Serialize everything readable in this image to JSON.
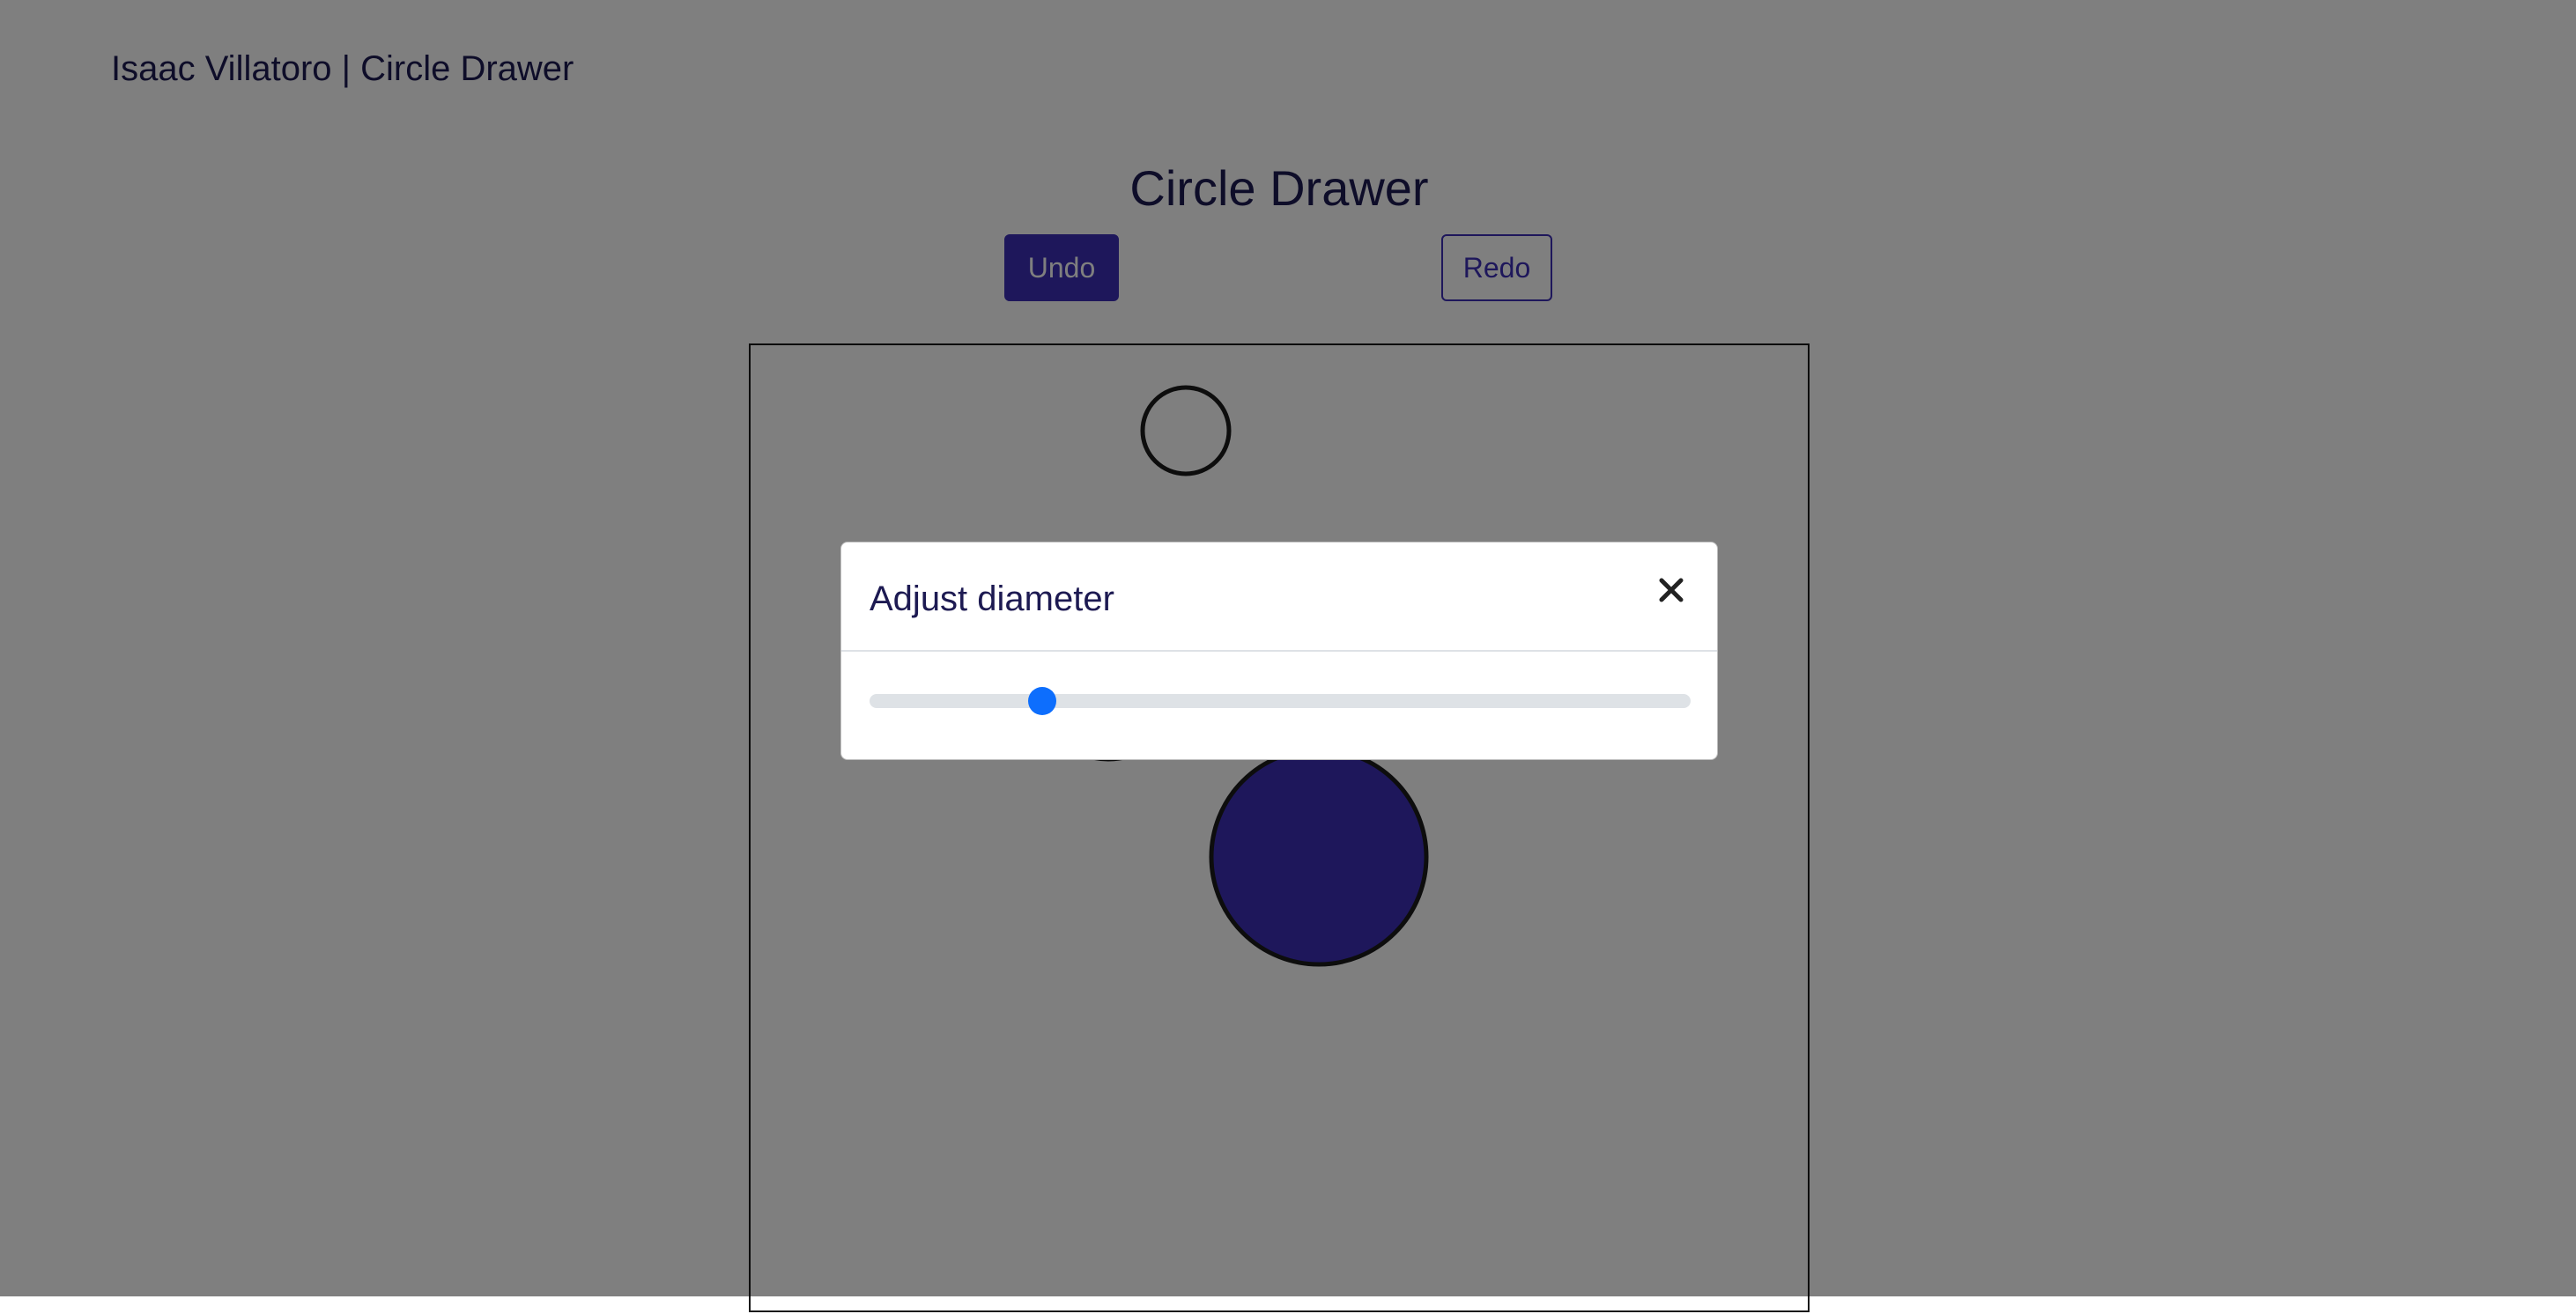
{
  "app": {
    "brand": "Isaac Villatoro | Circle Drawer",
    "title": "Circle Drawer"
  },
  "toolbar": {
    "undo_label": "Undo",
    "redo_label": "Redo"
  },
  "modal": {
    "title": "Adjust diameter",
    "close_icon": "close-icon",
    "slider": {
      "value_fraction": 0.2
    }
  },
  "colors": {
    "accent": "#3c2fb7",
    "circle_selected_fill": "#3c2fb7",
    "circle_stroke": "#1b1b1b",
    "slider_thumb": "#0d6efd",
    "text_dark": "#1d1a52"
  }
}
